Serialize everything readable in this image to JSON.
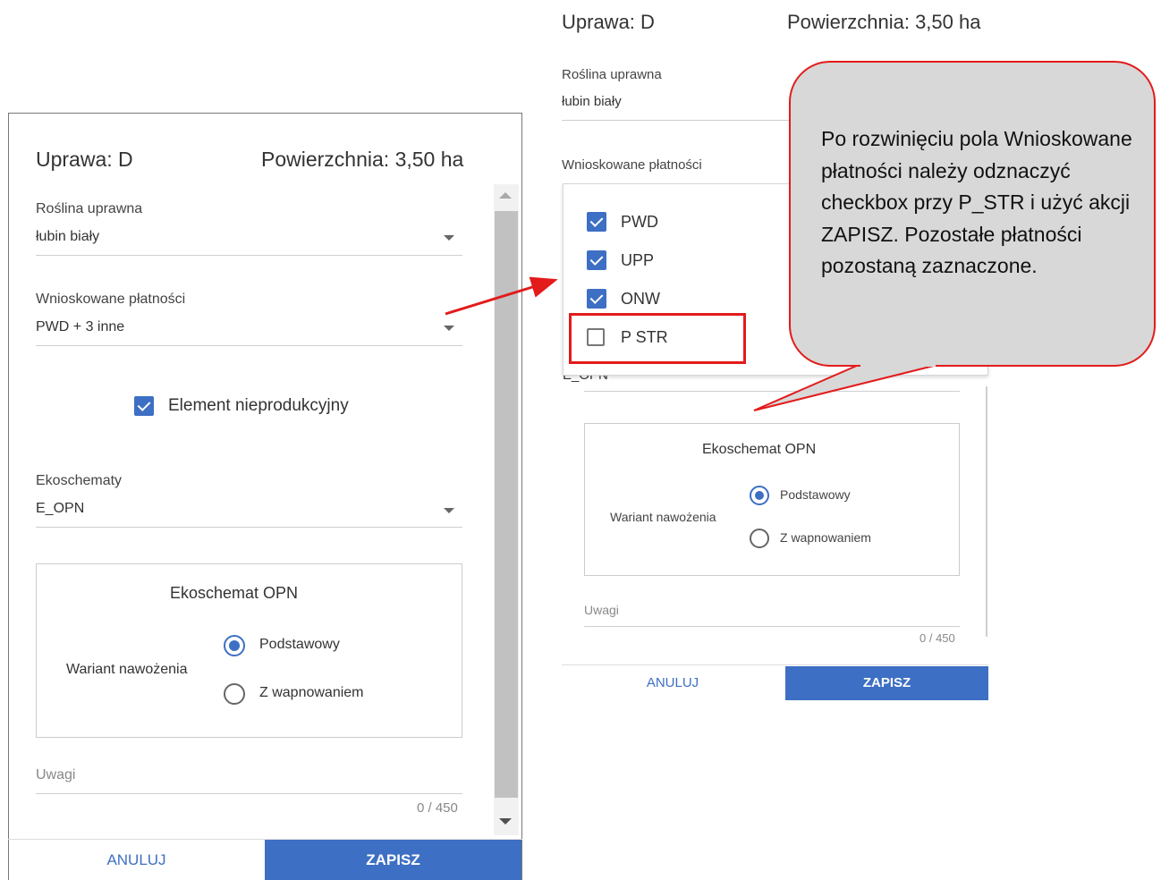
{
  "left_dialog": {
    "crop_label": "Uprawa: D",
    "area_label": "Powierzchnia: 3,50 ha",
    "crop_plant": {
      "label": "Roślina uprawna",
      "value": "łubin biały"
    },
    "payments": {
      "label": "Wnioskowane płatności",
      "value": "PWD + 3 inne"
    },
    "element_checkbox": {
      "label": "Element nieprodukcyjny",
      "checked": true
    },
    "ecoschemes": {
      "label": "Ekoschematy",
      "value": "E_OPN"
    },
    "opn_panel": {
      "title": "Ekoschemat OPN",
      "variant_label": "Wariant nawożenia",
      "options": [
        {
          "label": "Podstawowy",
          "selected": true
        },
        {
          "label": "Z wapnowaniem",
          "selected": false
        }
      ]
    },
    "notes": {
      "label": "Uwagi",
      "counter": "0 / 450"
    },
    "cancel_label": "ANULUJ",
    "save_label": "ZAPISZ"
  },
  "right_dialog": {
    "crop_label": "Uprawa: D",
    "area_label": "Powierzchnia: 3,50 ha",
    "crop_plant": {
      "label": "Roślina uprawna",
      "value": "łubin biały"
    },
    "payments_label": "Wnioskowane płatności",
    "payment_options": [
      {
        "label": "PWD",
        "checked": true
      },
      {
        "label": "UPP",
        "checked": true
      },
      {
        "label": "ONW",
        "checked": true
      },
      {
        "label": "P STR",
        "checked": false
      }
    ],
    "ecoscheme_value_partial": "E_OPN",
    "opn_panel": {
      "title": "Ekoschemat OPN",
      "variant_label": "Wariant nawożenia",
      "options": [
        {
          "label": "Podstawowy",
          "selected": true
        },
        {
          "label": "Z wapnowaniem",
          "selected": false
        }
      ]
    },
    "notes": {
      "label": "Uwagi",
      "counter": "0 / 450"
    },
    "cancel_label": "ANULUJ",
    "save_label": "ZAPISZ"
  },
  "callout": {
    "text": "Po rozwinięciu pola Wnioskowane płatności należy odznaczyć checkbox przy P_STR i użyć akcji ZAPISZ. Pozostałe płatności pozostaną zaznaczone."
  },
  "colors": {
    "accent": "#3d6fc4",
    "annotation": "#e31b1b",
    "callout_fill": "#d8d8d8"
  }
}
